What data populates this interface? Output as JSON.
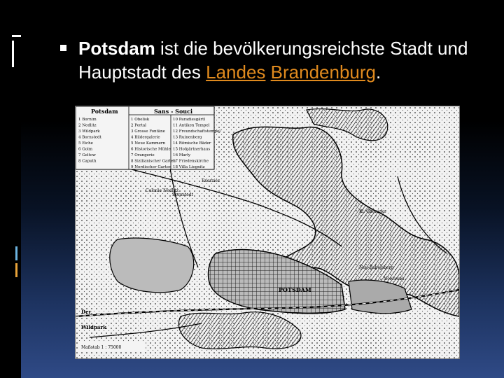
{
  "slide": {
    "bullet": {
      "bold": "Potsdam",
      "text1": " ist die bevölkerungsreichste Stadt und Hauptstadt des ",
      "link1": "Landes",
      "space": " ",
      "link2": "Brandenburg",
      "end": "."
    },
    "link_color": "#e08a1e"
  },
  "map": {
    "title_left": "Potsdam",
    "title_center": "Sans - Souci",
    "legend_left": [
      "1 Bornim",
      "2 Nedlitz",
      "3 Wildpark",
      "4 Bornstedt",
      "5 Eiche",
      "6 Golm",
      "7 Geltow",
      "8 Caputh"
    ],
    "legend_mid": [
      "1 Obelisk",
      "2 Portal",
      "3 Grosse Fontäne",
      "4 Bildergalerie",
      "5 Neue Kammern",
      "6 Historische Mühle",
      "7 Orangerie",
      "8 Sizilianischer Garten",
      "9 Nordischer Garten"
    ],
    "legend_right": [
      "10 Paradiesgärtl",
      "11 Antiken Tempel",
      "12 Freundschaftstempel",
      "13 Ruinenberg",
      "14 Römische Bäder",
      "15 Hofgärtnerhaus",
      "16 Marly",
      "17 Friedenskirche",
      "18 Villa Liegnitz"
    ],
    "labels": {
      "potsdam": "POTSDAM",
      "bornstedt": "Bornstedt",
      "wildpark": "Wildpark",
      "exerzier": "Exerzier",
      "babelsberg": "Neu-Babelsberg",
      "nowawes": "Nowawes",
      "glienicke": "Kl. Glienicke",
      "colonie": "Colonie Nedlitz",
      "der": "Der",
      "scale": "Maßstab 1 : 75000"
    }
  }
}
